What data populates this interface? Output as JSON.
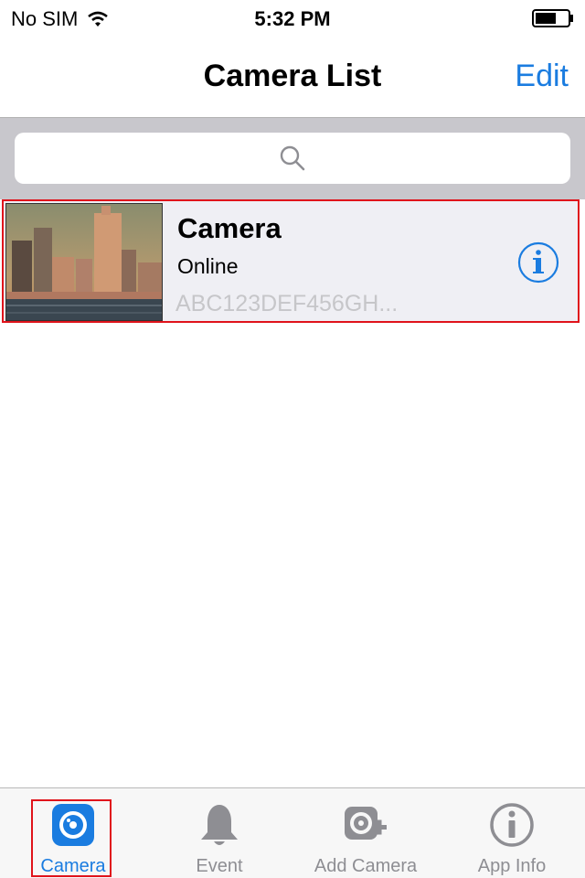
{
  "status_bar": {
    "carrier": "No SIM",
    "time": "5:32 PM"
  },
  "nav": {
    "title": "Camera List",
    "edit_label": "Edit"
  },
  "search": {
    "placeholder": ""
  },
  "cameras": [
    {
      "name": "Camera",
      "status": "Online",
      "id": "ABC123DEF456GH..."
    }
  ],
  "tabs": [
    {
      "label": "Camera",
      "icon": "camera-lens-icon",
      "active": true
    },
    {
      "label": "Event",
      "icon": "bell-icon",
      "active": false
    },
    {
      "label": "Add Camera",
      "icon": "add-camera-icon",
      "active": false
    },
    {
      "label": "App Info",
      "icon": "info-circle-icon",
      "active": false
    }
  ],
  "colors": {
    "accent": "#1a7ce0",
    "highlight": "#e0131b",
    "inactive": "#8e8e93"
  }
}
